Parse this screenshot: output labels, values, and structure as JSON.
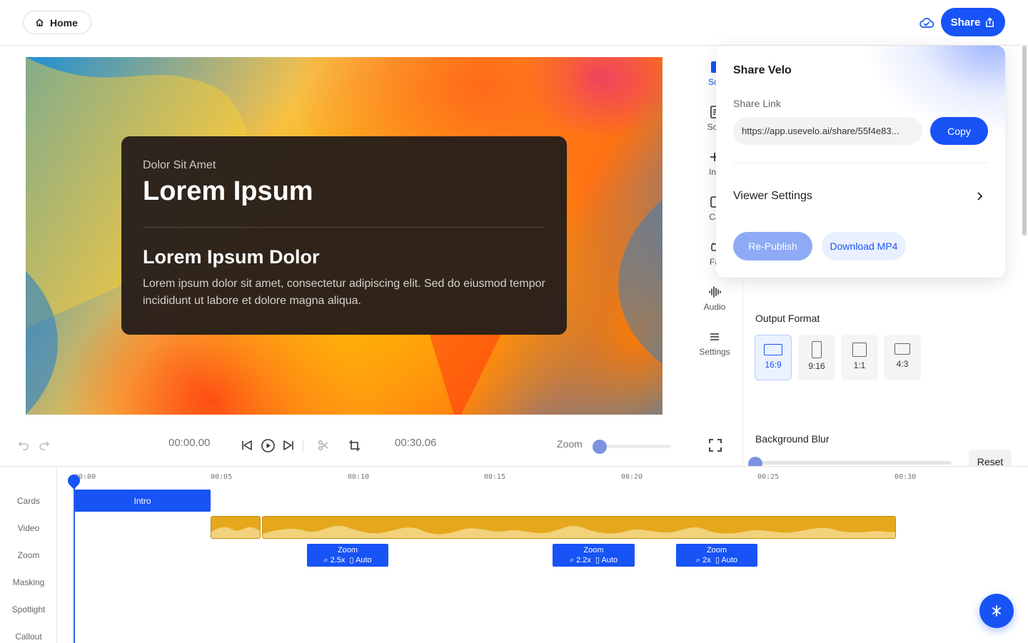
{
  "topbar": {
    "home_label": "Home",
    "share_label": "Share"
  },
  "preview": {
    "eyebrow": "Dolor Sit Amet",
    "title": "Lorem Ipsum",
    "subtitle": "Lorem Ipsum Dolor",
    "body": "Lorem ipsum dolor sit amet, consectetur adipiscing elit. Sed do eiusmod tempor incididunt ut labore et dolore magna aliqua."
  },
  "rail": {
    "items": [
      {
        "label": "Scr",
        "icon": "screen-icon"
      },
      {
        "label": "Scri",
        "icon": "script-icon"
      },
      {
        "label": "Ins",
        "icon": "insert-icon"
      },
      {
        "label": "Ca",
        "icon": "camera-icon"
      },
      {
        "label": "Fa",
        "icon": "face-icon"
      },
      {
        "label": "Audio",
        "icon": "audio-icon"
      },
      {
        "label": "Settings",
        "icon": "menu-icon"
      }
    ]
  },
  "panel": {
    "output_format_label": "Output Format",
    "formats": [
      {
        "label": "16:9",
        "active": true
      },
      {
        "label": "9:16",
        "active": false
      },
      {
        "label": "1:1",
        "active": false
      },
      {
        "label": "4:3",
        "active": false
      }
    ],
    "background_blur_label": "Background Blur",
    "reset_label": "Reset"
  },
  "playbar": {
    "current_time": "00:00.00",
    "total_time": "00:30.06",
    "zoom_label": "Zoom"
  },
  "share_popover": {
    "title": "Share Velo",
    "share_link_label": "Share Link",
    "share_link_value": "https://app.usevelo.ai/share/55f4e83...",
    "copy_label": "Copy",
    "viewer_settings_label": "Viewer Settings",
    "republish_label": "Re-Publish",
    "download_label": "Download MP4"
  },
  "timeline": {
    "track_labels": [
      "Cards",
      "Video",
      "Zoom",
      "Masking",
      "Spotlight",
      "Callout"
    ],
    "ticks": [
      "00:00",
      "00:05",
      "00:10",
      "00:15",
      "00:20",
      "00:25",
      "00:30"
    ],
    "intro_card_label": "Intro",
    "zoom_blocks": [
      {
        "title": "Zoom",
        "level": "2.5x",
        "mode": "Auto"
      },
      {
        "title": "Zoom",
        "level": "2.2x",
        "mode": "Auto"
      },
      {
        "title": "Zoom",
        "level": "2x",
        "mode": "Auto"
      }
    ]
  },
  "colors": {
    "accent": "#1853f5",
    "clip": "#e5a81c"
  }
}
